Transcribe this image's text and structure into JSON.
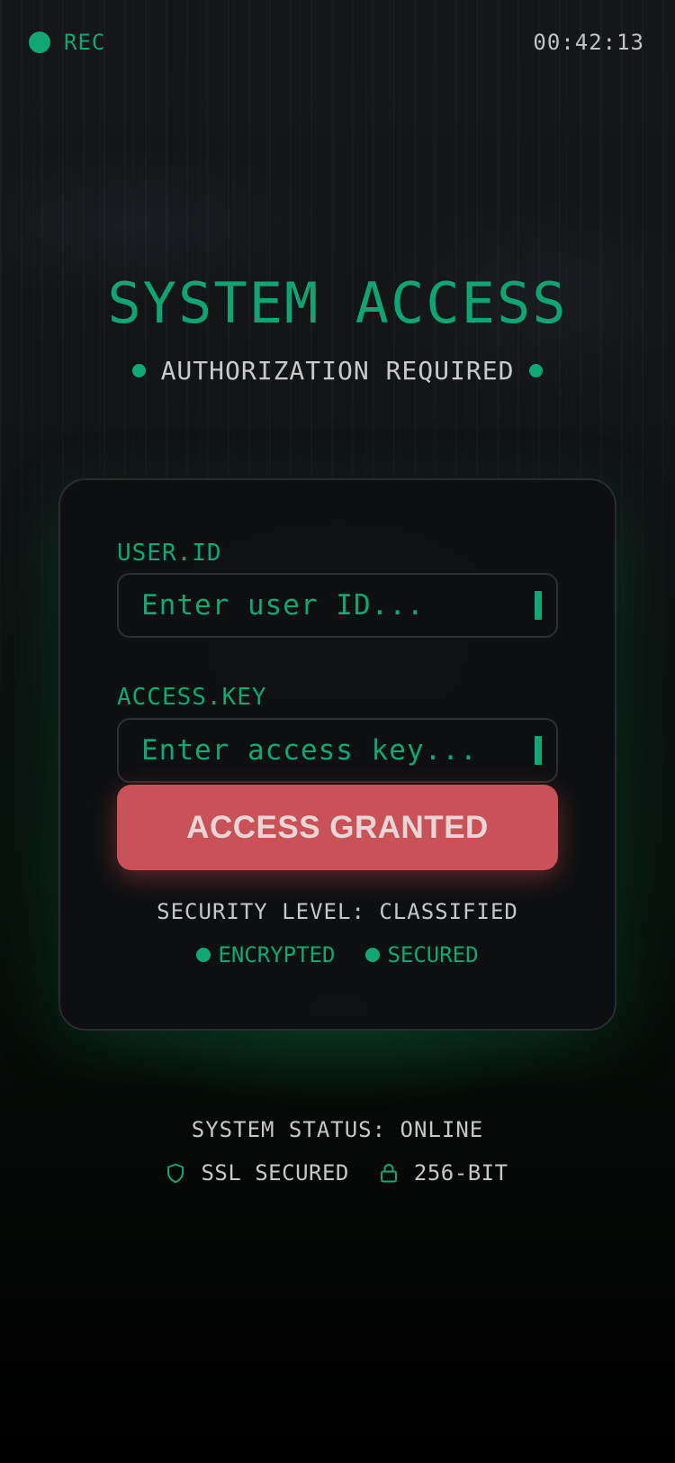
{
  "status_bar": {
    "rec_label": "REC",
    "timer": "00:42:13"
  },
  "header": {
    "title": "SYSTEM ACCESS",
    "subtitle": "AUTHORIZATION REQUIRED"
  },
  "form": {
    "user_id": {
      "label": "USER.ID",
      "placeholder": "Enter user ID...",
      "value": ""
    },
    "access_key": {
      "label": "ACCESS.KEY",
      "placeholder": "Enter access key...",
      "value": ""
    },
    "submit_label": "ACCESS GRANTED",
    "security_level": "SECURITY LEVEL: CLASSIFIED",
    "badges": [
      "ENCRYPTED",
      "SECURED"
    ]
  },
  "footer": {
    "system_status": "SYSTEM STATUS: ONLINE",
    "ssl_label": "SSL SECURED",
    "encryption_label": "256-BIT",
    "icons": [
      "shield-icon",
      "lock-icon"
    ]
  },
  "colors": {
    "accent": "#0fa874",
    "button": "#c85257",
    "background": "#000000",
    "muted_text": "#c7c7c7"
  }
}
